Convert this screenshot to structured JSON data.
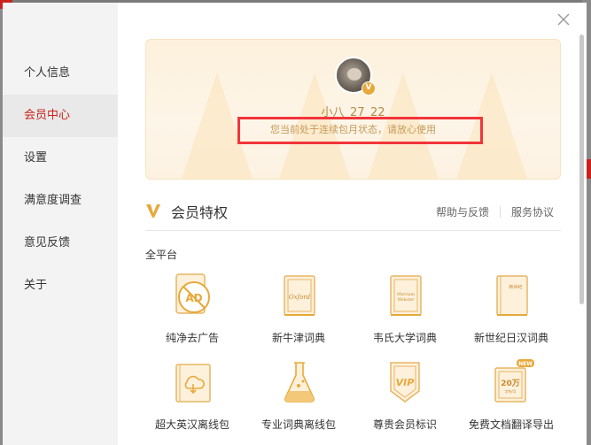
{
  "sidebar": {
    "items": [
      {
        "label": "个人信息"
      },
      {
        "label": "会员中心"
      },
      {
        "label": "设置"
      },
      {
        "label": "满意度调查"
      },
      {
        "label": "意见反馈"
      },
      {
        "label": "关于"
      }
    ],
    "active_index": 1
  },
  "profile": {
    "username": "小八_27_22",
    "status": "您当前处于连续包月状态，请放心使用",
    "badge": "V"
  },
  "privileges": {
    "title": "会员特权",
    "help_link": "帮助与反馈",
    "service_link": "服务协议",
    "platform_label": "全平台",
    "features": [
      {
        "label": "纯净去广告",
        "icon": "no-ads-icon",
        "icon_text": "AD"
      },
      {
        "label": "新牛津词典",
        "icon": "oxford-dictionary-icon",
        "icon_text": "Oxford"
      },
      {
        "label": "韦氏大学词典",
        "icon": "merriam-webster-icon",
        "icon_text": "Merriam Webster"
      },
      {
        "label": "新世纪日汉词典",
        "icon": "japanese-dictionary-icon",
        "icon_text": "新世纪"
      },
      {
        "label": "超大英汉离线包",
        "icon": "offline-package-icon",
        "icon_text": ""
      },
      {
        "label": "专业词典离线包",
        "icon": "flask-icon",
        "icon_text": ""
      },
      {
        "label": "尊贵会员标识",
        "icon": "vip-badge-icon",
        "icon_text": "VIP"
      },
      {
        "label": "免费文档翻译导出",
        "icon": "document-translate-icon",
        "icon_text": "20万",
        "icon_subtext": "字符/月",
        "badge": "NEW"
      }
    ]
  },
  "colors": {
    "accent": "#c8231d",
    "gold": "#e8a93a",
    "highlight": "#f2353a"
  }
}
